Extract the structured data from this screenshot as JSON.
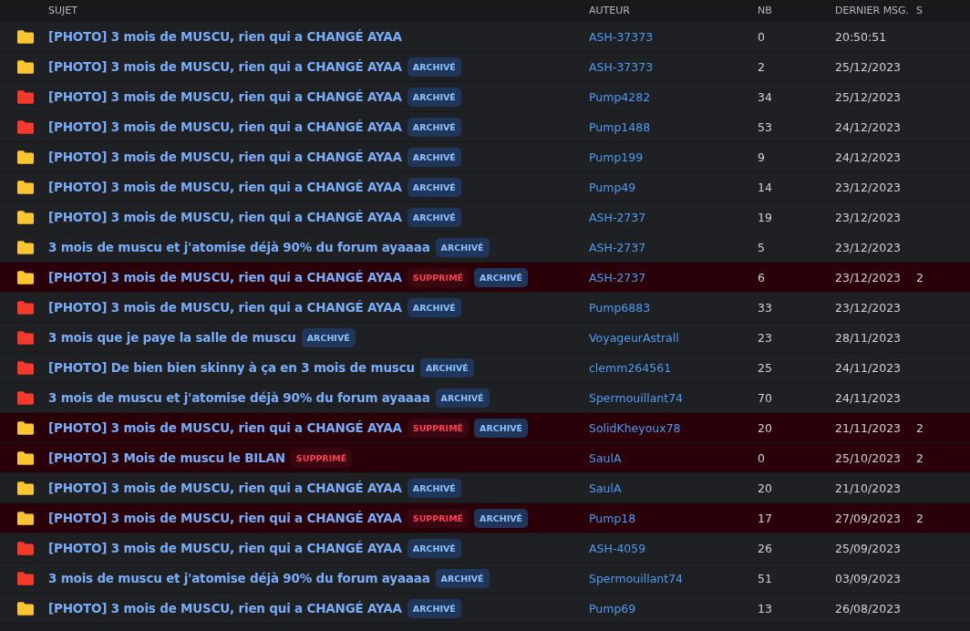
{
  "table": {
    "columns": [
      "SUJET",
      "AUTEUR",
      "NB",
      "DERNIER MSG.",
      "S"
    ],
    "rows": [
      {
        "color": "#fdc52f",
        "deleted": false,
        "title": "[PHOTO] 3 mois de MUSCU, rien qui a CHANGÉ AYAA",
        "badges": [],
        "author": "ASH-37373",
        "count": "0",
        "last": "20:50:51"
      },
      {
        "color": "#fdc52f",
        "deleted": false,
        "title": "[PHOTO] 3 mois de MUSCU, rien qui a CHANGÉ AYAA",
        "badges": [
          {
            "kind": "archived",
            "label": "ARCHIVÉ"
          }
        ],
        "author": "ASH-37373",
        "count": "2",
        "last": "25/12/2023"
      },
      {
        "color": "#f5392b",
        "deleted": false,
        "title": "[PHOTO] 3 mois de MUSCU, rien qui a CHANGÉ AYAA",
        "badges": [
          {
            "kind": "archived",
            "label": "ARCHIVÉ"
          }
        ],
        "author": "Pump4282",
        "count": "34",
        "last": "25/12/2023"
      },
      {
        "color": "#f5392b",
        "deleted": false,
        "title": "[PHOTO] 3 mois de MUSCU, rien qui a CHANGÉ AYAA",
        "badges": [
          {
            "kind": "archived",
            "label": "ARCHIVÉ"
          }
        ],
        "author": "Pump1488",
        "count": "53",
        "last": "24/12/2023"
      },
      {
        "color": "#fdc52f",
        "deleted": false,
        "title": "[PHOTO] 3 mois de MUSCU, rien qui a CHANGÉ AYAA",
        "badges": [
          {
            "kind": "archived",
            "label": "ARCHIVÉ"
          }
        ],
        "author": "Pump199",
        "count": "9",
        "last": "24/12/2023"
      },
      {
        "color": "#fdc52f",
        "deleted": false,
        "title": "[PHOTO] 3 mois de MUSCU, rien qui a CHANGÉ AYAA",
        "badges": [
          {
            "kind": "archived",
            "label": "ARCHIVÉ"
          }
        ],
        "author": "Pump49",
        "count": "14",
        "last": "23/12/2023"
      },
      {
        "color": "#fdc52f",
        "deleted": false,
        "title": "[PHOTO] 3 mois de MUSCU, rien qui a CHANGÉ AYAA",
        "badges": [
          {
            "kind": "archived",
            "label": "ARCHIVÉ"
          }
        ],
        "author": "ASH-2737",
        "count": "19",
        "last": "23/12/2023"
      },
      {
        "color": "#fdc52f",
        "deleted": false,
        "title": "3 mois de muscu et j'atomise déjà 90% du forum ayaaaa",
        "badges": [
          {
            "kind": "archived",
            "label": "ARCHIVÉ"
          }
        ],
        "author": "ASH-2737",
        "count": "5",
        "last": "23/12/2023"
      },
      {
        "color": "#fdc52f",
        "deleted": true,
        "title": "[PHOTO] 3 mois de MUSCU, rien qui a CHANGÉ AYAA",
        "badges": [
          {
            "kind": "deleted",
            "label": "SUPPRIMÉ"
          },
          {
            "kind": "archived",
            "label": "ARCHIVÉ"
          }
        ],
        "author": "ASH-2737",
        "count": "6",
        "last": "23/12/2023",
        "column_5": "2"
      },
      {
        "color": "#f5392b",
        "deleted": false,
        "title": "[PHOTO] 3 mois de MUSCU, rien qui a CHANGÉ AYAA",
        "badges": [
          {
            "kind": "archived",
            "label": "ARCHIVÉ"
          }
        ],
        "author": "Pump6883",
        "count": "33",
        "last": "23/12/2023"
      },
      {
        "color": "#f5392b",
        "deleted": false,
        "title": "3 mois que je paye la salle de muscu",
        "badges": [
          {
            "kind": "archived",
            "label": "ARCHIVÉ"
          }
        ],
        "author": "VoyageurAstrall",
        "count": "23",
        "last": "28/11/2023"
      },
      {
        "color": "#f5392b",
        "deleted": false,
        "title": "[PHOTO] De bien bien skinny à ça en 3 mois de muscu",
        "badges": [
          {
            "kind": "archived",
            "label": "ARCHIVÉ"
          }
        ],
        "author": "clemm264561",
        "count": "25",
        "last": "24/11/2023"
      },
      {
        "color": "#f5392b",
        "deleted": false,
        "title": "3 mois de muscu et j'atomise déjà 90% du forum ayaaaa",
        "badges": [
          {
            "kind": "archived",
            "label": "ARCHIVÉ"
          }
        ],
        "author": "Spermouillant74",
        "count": "70",
        "last": "24/11/2023"
      },
      {
        "color": "#fdc52f",
        "deleted": true,
        "title": "[PHOTO] 3 mois de MUSCU, rien qui a CHANGÉ AYAA",
        "badges": [
          {
            "kind": "deleted",
            "label": "SUPPRIMÉ"
          },
          {
            "kind": "archived",
            "label": "ARCHIVÉ"
          }
        ],
        "author": "SolidKheyoux78",
        "count": "20",
        "last": "21/11/2023",
        "column_5": "2"
      },
      {
        "color": "#fdc52f",
        "deleted": true,
        "title": "[PHOTO] 3 Mois de muscu le BILAN",
        "badges": [
          {
            "kind": "deleted",
            "label": "SUPPRIMÉ"
          }
        ],
        "author": "SaulA",
        "count": "0",
        "last": "25/10/2023",
        "column_5": "2"
      },
      {
        "color": "#fdc52f",
        "deleted": false,
        "title": "[PHOTO] 3 mois de MUSCU, rien qui a CHANGÉ AYAA",
        "badges": [
          {
            "kind": "archived",
            "label": "ARCHIVÉ"
          }
        ],
        "author": "SaulA",
        "count": "20",
        "last": "21/10/2023"
      },
      {
        "color": "#fdc52f",
        "deleted": true,
        "title": "[PHOTO] 3 mois de MUSCU, rien qui a CHANGÉ AYAA",
        "badges": [
          {
            "kind": "deleted",
            "label": "SUPPRIMÉ"
          },
          {
            "kind": "archived",
            "label": "ARCHIVÉ"
          }
        ],
        "author": "Pump18",
        "count": "17",
        "last": "27/09/2023",
        "column_5": "2"
      },
      {
        "color": "#f5392b",
        "deleted": false,
        "title": "[PHOTO] 3 mois de MUSCU, rien qui a CHANGÉ AYAA",
        "badges": [
          {
            "kind": "archived",
            "label": "ARCHIVÉ"
          }
        ],
        "author": "ASH-4059",
        "count": "26",
        "last": "25/09/2023"
      },
      {
        "color": "#f5392b",
        "deleted": false,
        "title": "3 mois de muscu et j'atomise déjà 90% du forum ayaaaa",
        "badges": [
          {
            "kind": "archived",
            "label": "ARCHIVÉ"
          }
        ],
        "author": "Spermouillant74",
        "count": "51",
        "last": "03/09/2023"
      },
      {
        "color": "#fdc52f",
        "deleted": false,
        "title": "[PHOTO] 3 mois de MUSCU, rien qui a CHANGÉ AYAA",
        "badges": [
          {
            "kind": "archived",
            "label": "ARCHIVÉ"
          }
        ],
        "author": "Pump69",
        "count": "13",
        "last": "26/08/2023"
      }
    ]
  }
}
